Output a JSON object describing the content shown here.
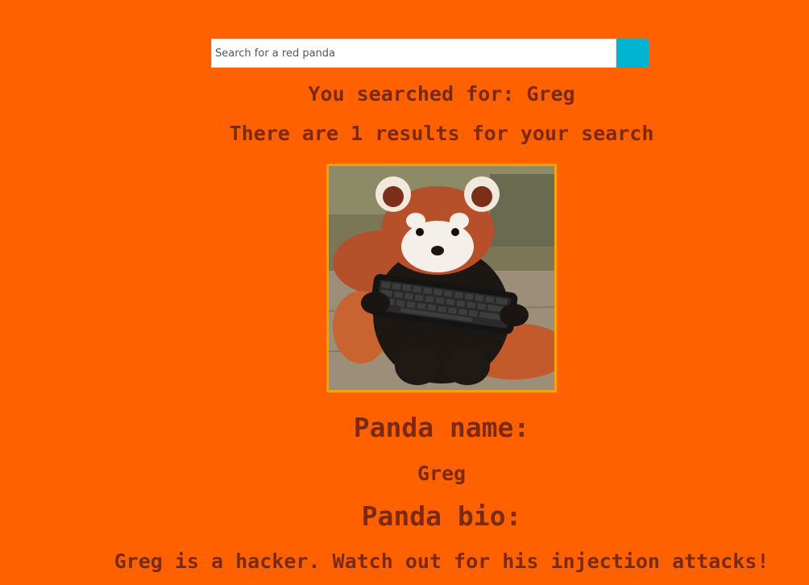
{
  "search": {
    "placeholder": "Search for a red panda",
    "value": ""
  },
  "results": {
    "searched_for": "You searched for: Greg",
    "count_text": "There are 1 results for your search"
  },
  "panda": {
    "image_icon": "red-panda-holding-keyboard-photo",
    "name_heading": "Panda name:",
    "name": "Greg",
    "bio_heading": "Panda bio:",
    "bio": "Greg is a hacker. Watch out for his injection attacks!"
  },
  "colors": {
    "background": "#ff6100",
    "text": "#7a2a10",
    "search_button": "#00b3d0",
    "image_border": "#ffa200"
  }
}
